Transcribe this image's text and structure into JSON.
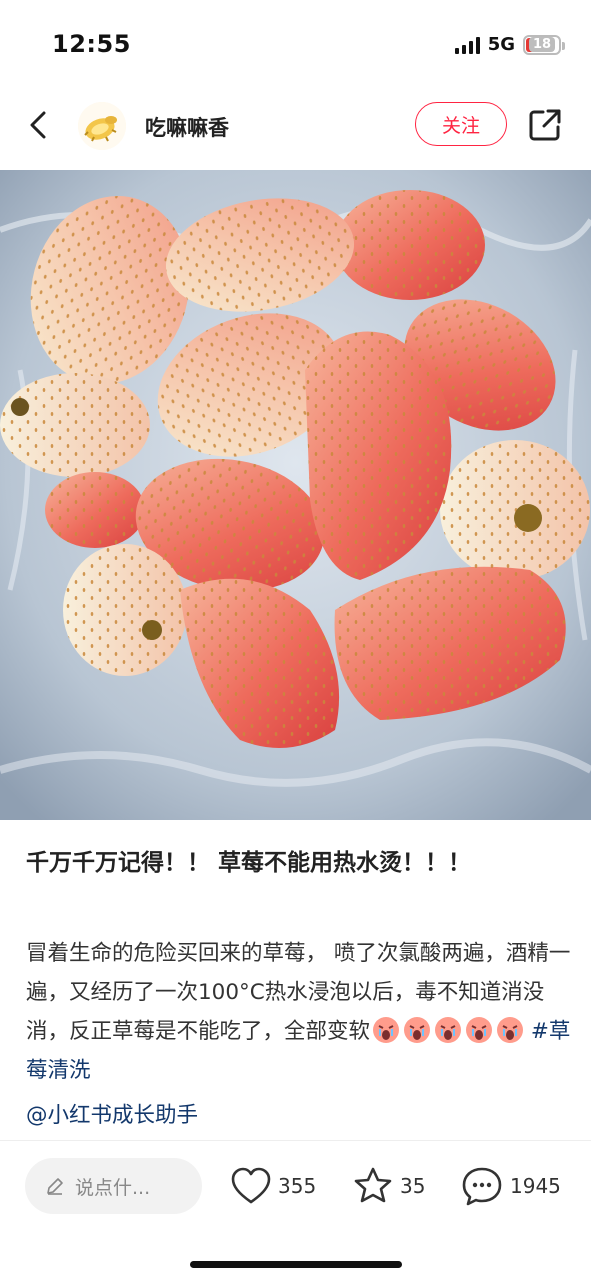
{
  "status_bar": {
    "time": "12:55",
    "network": "5G",
    "battery": "18"
  },
  "header": {
    "author": "吃嘛嘛香",
    "follow_label": "关注"
  },
  "post": {
    "title": "千万千万记得！！ 草莓不能用热水烫！！！",
    "body": "冒着生命的危险买回来的草莓， 喷了次氯酸两遍，酒精一遍，又经历了一次100°C热水浸泡以后，毒不知道消没消，反正草莓是不能吃了，全部变软",
    "hashtag": "#草莓清洗",
    "mention": "@小红书成长助手",
    "emoji_icon": "crying-face-emoji"
  },
  "bottom_bar": {
    "comment_placeholder": "说点什...",
    "likes": "355",
    "favorites": "35",
    "comments": "1945"
  },
  "colors": {
    "accent": "#ff2442",
    "link": "#13386c"
  }
}
